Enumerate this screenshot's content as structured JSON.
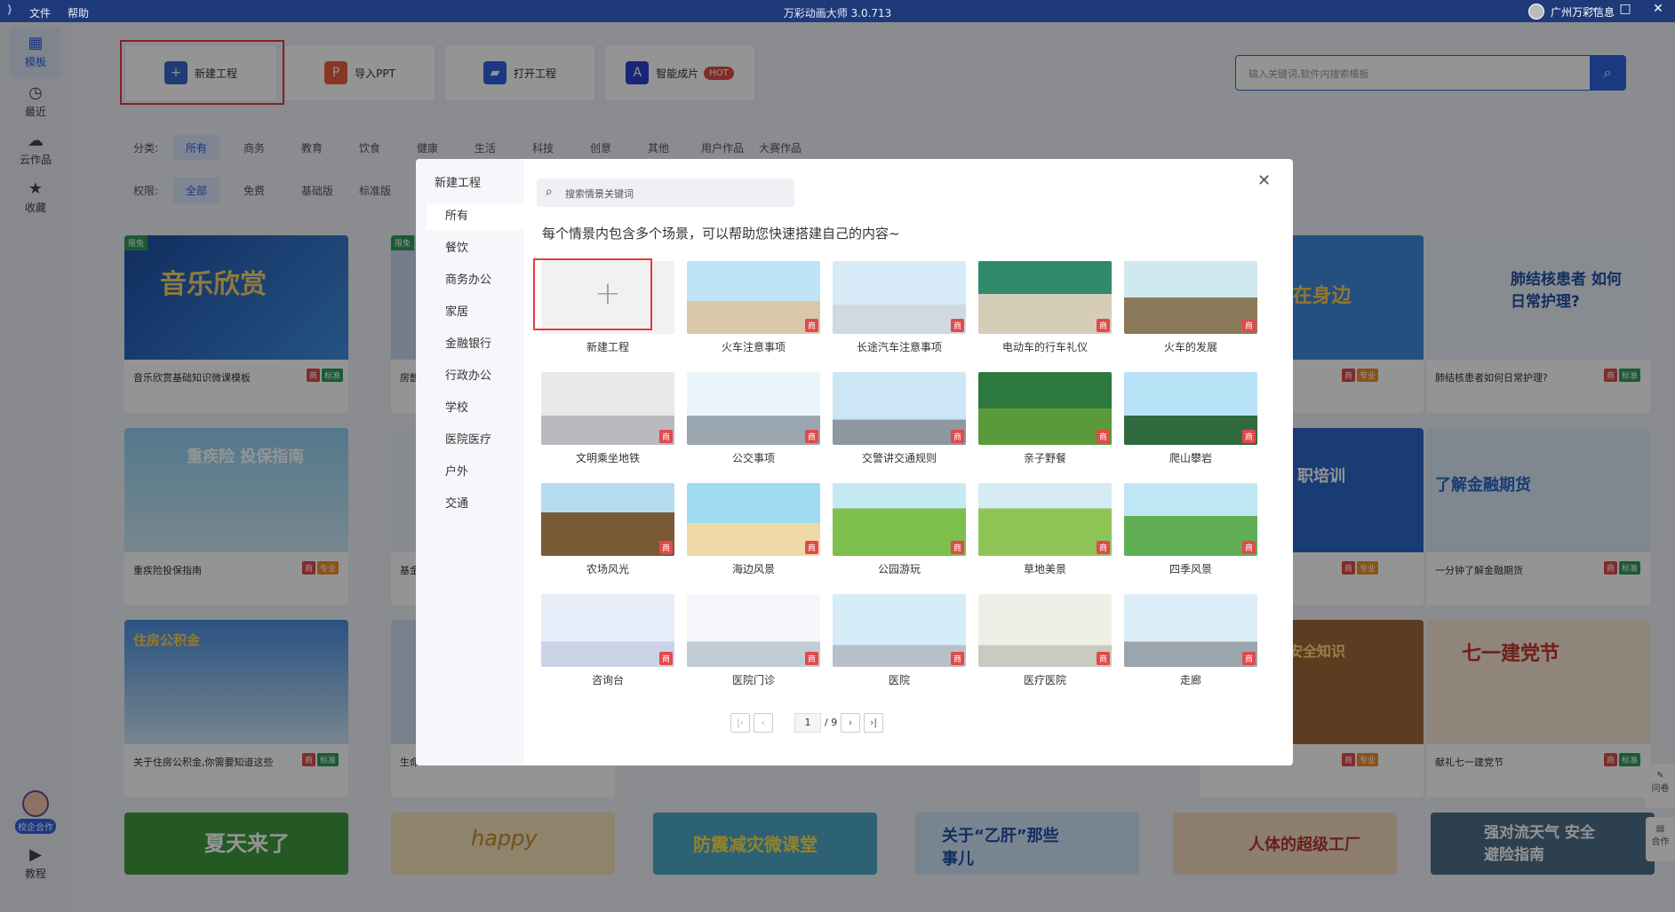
{
  "titlebar": {
    "menu": [
      "文件",
      "帮助"
    ],
    "title": "万彩动画大师 3.0.713",
    "user": "广州万彩信息",
    "window_buttons": [
      "—",
      "□",
      "✕"
    ]
  },
  "sidebar": {
    "items": [
      {
        "label": "模板",
        "icon": "grid-icon"
      },
      {
        "label": "最近",
        "icon": "clock-icon"
      },
      {
        "label": "云作品",
        "icon": "cloud-icon"
      },
      {
        "label": "收藏",
        "icon": "star-icon"
      }
    ],
    "coop_label": "校企合作",
    "tutorial_label": "教程"
  },
  "toolbar": {
    "new_project": "新建工程",
    "import_ppt": "导入PPT",
    "open_project": "打开工程",
    "smart": "智能成片",
    "hot": "HOT"
  },
  "search": {
    "placeholder": "输入关键词,软件内搜索模板"
  },
  "filters": {
    "category_label": "分类:",
    "categories": [
      "所有",
      "商务",
      "教育",
      "饮食",
      "健康",
      "生活",
      "科技",
      "创意",
      "其他",
      "用户作品",
      "大赛作品"
    ],
    "permission_label": "权限:",
    "permissions": [
      "全部",
      "免费",
      "基础版",
      "标准版"
    ]
  },
  "cards": [
    {
      "caption": "音乐欣赏基础知识微课模板",
      "tag": "标准",
      "promo": "限免",
      "title": "音乐欣赏"
    },
    {
      "caption": "房颤",
      "tag": "",
      "promo": "限免",
      "title": ""
    },
    {
      "caption": "肺结核患者如何日常护理?",
      "tag": "标准",
      "promo": "",
      "title": "肺结核患者 如何日常护理?"
    },
    {
      "caption": "重疾险投保指南",
      "tag": "专业",
      "promo": "",
      "title": "重疾险 投保指南"
    },
    {
      "caption": "基金",
      "tag": "",
      "promo": "",
      "title": ""
    },
    {
      "caption": "一分钟了解金融期货",
      "tag": "标准",
      "promo": "",
      "title": "了解金融期货"
    },
    {
      "caption": "关于住房公积金,你需要知道这些",
      "tag": "标准",
      "promo": "",
      "title": "住房公积金"
    },
    {
      "caption": "生命",
      "tag": "",
      "promo": "",
      "title": ""
    },
    {
      "caption": "献礼七一建党节",
      "tag": "标准",
      "promo": "",
      "title": "七一建党节"
    },
    {
      "caption": "",
      "tag": "",
      "promo": "",
      "title": "夏天来了"
    },
    {
      "caption": "",
      "tag": "",
      "promo": "",
      "title": "happy"
    },
    {
      "caption": "",
      "tag": "",
      "promo": "",
      "title": "防震减灾微课堂"
    },
    {
      "caption": "",
      "tag": "",
      "promo": "",
      "title": "关于“乙肝”那些事儿"
    },
    {
      "caption": "",
      "tag": "",
      "promo": "",
      "title": "人体的超级工厂"
    },
    {
      "caption": "",
      "tag": "",
      "promo": "",
      "title": "强对流天气 安全避险指南"
    }
  ],
  "partial_titles": {
    "behind_1": "”在身边",
    "behind_2": "职培训",
    "behind_3": "安全知识",
    "tag_shang": "商",
    "tag_pro": "专业"
  },
  "right_float": [
    "问卷",
    "合作"
  ],
  "modal": {
    "sidebar_title": "新建工程",
    "categories": [
      "所有",
      "餐饮",
      "商务办公",
      "家居",
      "金融银行",
      "行政办公",
      "学校",
      "医院医疗",
      "户外",
      "交通"
    ],
    "search_placeholder": "搜索情景关键词",
    "description": "每个情景内包含多个场景，可以帮助您快速搭建自己的内容~",
    "new_tile": "新建工程",
    "tiles": [
      "火车注意事项",
      "长途汽车注意事项",
      "电动车的行车礼仪",
      "火车的发展",
      "文明乘坐地铁",
      "公交事项",
      "交警讲交通规则",
      "亲子野餐",
      "爬山攀岩",
      "农场风光",
      "海边风景",
      "公园游玩",
      "草地美景",
      "四季风景",
      "咨询台",
      "医院门诊",
      "医院",
      "医疗医院",
      "走廊"
    ],
    "badge": "商",
    "pager": {
      "first": "|‹",
      "prev": "‹",
      "page": "1",
      "total": "/ 9",
      "next": "›",
      "last": "›|"
    }
  }
}
